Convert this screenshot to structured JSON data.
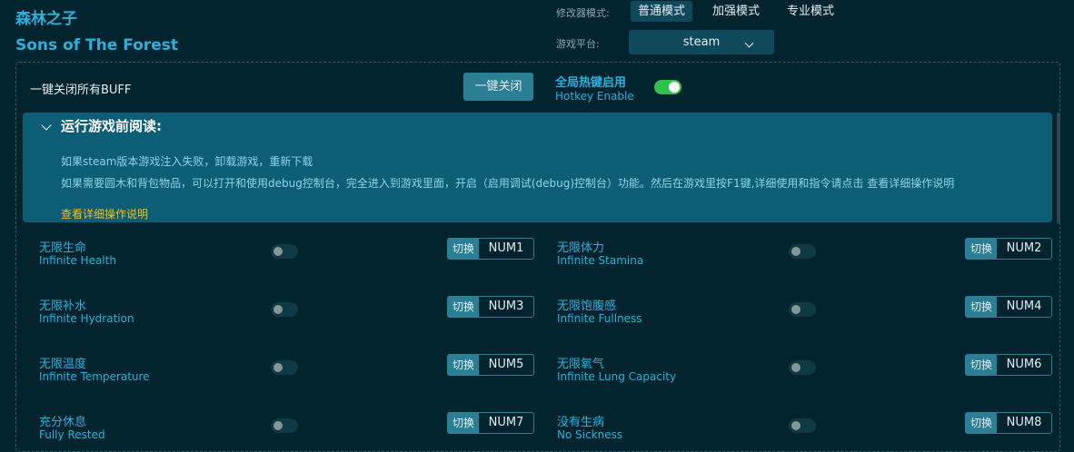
{
  "header": {
    "title_cn": "森林之子",
    "title_en": "Sons of The Forest"
  },
  "mode": {
    "label": "修改器模式:",
    "options": [
      "普通模式",
      "加强模式",
      "专业模式"
    ],
    "selected": "普通模式"
  },
  "platform": {
    "label": "游戏平台:",
    "value": "steam"
  },
  "buff": {
    "label": "一键关闭所有BUFF",
    "button": "一键关闭"
  },
  "hotkey": {
    "label_cn": "全局热键启用",
    "label_en": "Hotkey Enable",
    "enabled": true
  },
  "notice": {
    "title": "运行游戏前阅读:",
    "line1": "如果steam版本游戏注入失败，卸载游戏，重新下载",
    "line2": "如果需要圆木和背包物品，可以打开和使用debug控制台，完全进入到游戏里面，开启（启用调试(debug)控制台）功能。然后在游戏里按F1键,详细使用和指令请点击 查看详细操作说明",
    "link": "查看详细操作说明"
  },
  "switch_label": "切换",
  "features": [
    {
      "cn": "无限生命",
      "en": "Infinite Health",
      "key": "NUM1",
      "on": false
    },
    {
      "cn": "无限体力",
      "en": "Infinite Stamina",
      "key": "NUM2",
      "on": false
    },
    {
      "cn": "无限补水",
      "en": "Infinite Hydration",
      "key": "NUM3",
      "on": false
    },
    {
      "cn": "无限饱腹感",
      "en": "Infinite Fullness",
      "key": "NUM4",
      "on": false
    },
    {
      "cn": "无限温度",
      "en": "Infinite Temperature",
      "key": "NUM5",
      "on": false
    },
    {
      "cn": "无限氧气",
      "en": "Infinite Lung Capacity",
      "key": "NUM6",
      "on": false
    },
    {
      "cn": "充分休息",
      "en": "Fully Rested",
      "key": "NUM7",
      "on": false
    },
    {
      "cn": "没有生病",
      "en": "No Sickness",
      "key": "NUM8",
      "on": false
    }
  ]
}
